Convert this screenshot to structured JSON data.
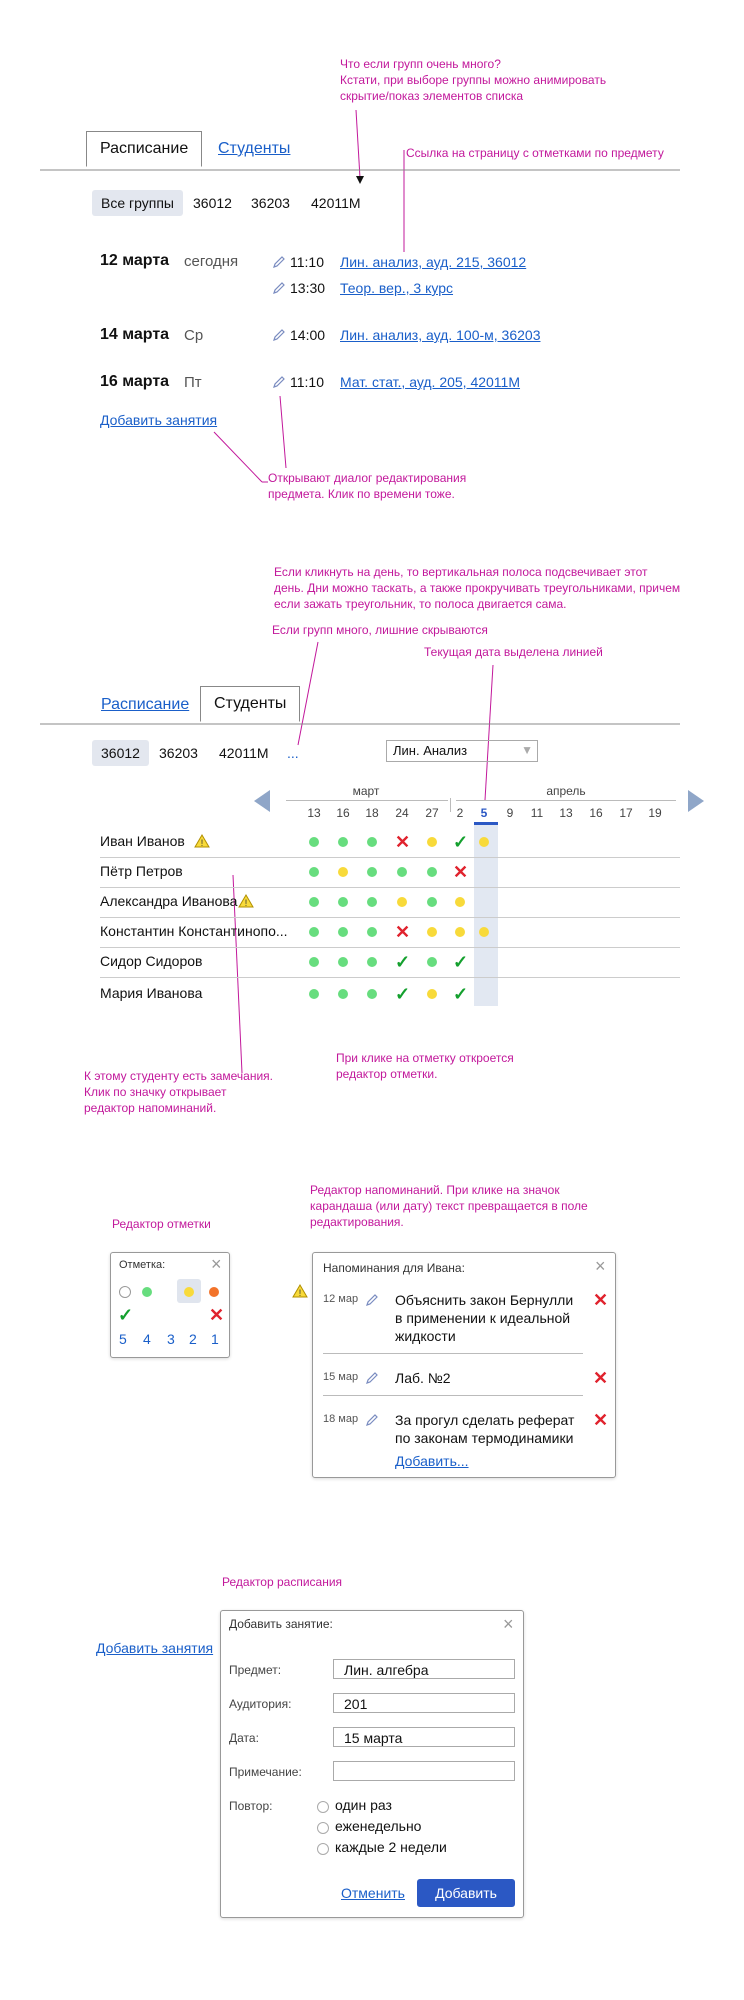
{
  "notes": {
    "many_groups": [
      "Что если групп очень много?",
      "Кстати, при выборе группы можно анимировать",
      "скрытие/показ элементов списка"
    ],
    "link_page": "Ссылка на страницу с отметками по предмету",
    "dialog": [
      "Открывают диалог редактирования",
      "предмета. Клик по времени тоже."
    ],
    "day_click": [
      "Если кликнуть на день, то вертикальная полоса подсвечивает этот",
      "день. Дни можно таскать, а  также прокручивать треугольниками, причем",
      "если зажать треугольник, то полоса двигается сама."
    ],
    "hidden_groups": "Если групп много, лишние скрываются",
    "current_date": "Текущая дата выделена линией",
    "student_remarks": [
      "К этому студенту есть замечания.",
      "Клик по значку открывает",
      "редактор напоминаний."
    ],
    "mark_click": [
      "При клике на отметку откроется",
      "редактор отметки."
    ],
    "mark_editor": "Редактор отметки",
    "reminder_editor": [
      "Редактор напоминаний. При клике на значок",
      "карандаша (или дату) текст превращается в поле",
      "редактирования."
    ],
    "schedule_editor": "Редактор расписания"
  },
  "schedule": {
    "tabs": {
      "schedule": "Расписание",
      "students": "Студенты"
    },
    "groups": [
      "Все группы",
      "36012",
      "36203",
      "42011M"
    ],
    "days": [
      {
        "date": "12 марта",
        "weekday": "сегодня",
        "classes": [
          {
            "time": "11:10",
            "title": "Лин. анализ, ауд. 215, 36012"
          },
          {
            "time": "13:30",
            "title": "Теор. вер., 3 курс"
          }
        ]
      },
      {
        "date": "14 марта",
        "weekday": "Ср",
        "classes": [
          {
            "time": "14:00",
            "title": "Лин. анализ, ауд. 100-м, 36203"
          }
        ]
      },
      {
        "date": "16 марта",
        "weekday": "Пт",
        "classes": [
          {
            "time": "11:10",
            "title": "Мат. стат., ауд. 205, 42011M"
          }
        ]
      }
    ],
    "add_lesson": "Добавить занятия"
  },
  "students": {
    "tabs": {
      "schedule": "Расписание",
      "students": "Студенты"
    },
    "groups": [
      "36012",
      "36203",
      "42011M"
    ],
    "more": "...",
    "subject_select": "Лин. Анализ",
    "months": {
      "march": "март",
      "april": "апрель"
    },
    "dates": [
      "13",
      "16",
      "18",
      "24",
      "27",
      "2",
      "5",
      "9",
      "11",
      "13",
      "16",
      "17",
      "19"
    ],
    "current_date_index": 6,
    "rows": [
      {
        "name": "Иван Иванов",
        "warn": true,
        "marks": [
          "g",
          "g",
          "g",
          "x",
          "y",
          "c",
          "y"
        ]
      },
      {
        "name": "Пётр Петров",
        "warn": false,
        "marks": [
          "g",
          "y",
          "g",
          "g",
          "g",
          "x",
          ""
        ]
      },
      {
        "name": "Александра Иванова",
        "warn": true,
        "marks": [
          "g",
          "g",
          "g",
          "y",
          "g",
          "y",
          ""
        ]
      },
      {
        "name": "Константин Константинопо...",
        "warn": false,
        "marks": [
          "g",
          "g",
          "g",
          "x",
          "y",
          "y",
          "y"
        ]
      },
      {
        "name": "Сидор Сидоров",
        "warn": false,
        "marks": [
          "g",
          "g",
          "g",
          "c",
          "g",
          "c",
          ""
        ]
      },
      {
        "name": "Мария Иванова",
        "warn": false,
        "marks": [
          "g",
          "g",
          "g",
          "c",
          "y",
          "c",
          ""
        ]
      }
    ]
  },
  "mark_editor": {
    "title": "Отметка:",
    "grades": [
      "5",
      "4",
      "3",
      "2",
      "1"
    ]
  },
  "reminders": {
    "title": "Напоминания для Ивана:",
    "items": [
      {
        "date": "12 мар",
        "text": [
          "Объяснить закон Бернулли",
          "в применении к идеальной",
          "жидкости"
        ]
      },
      {
        "date": "15 мар",
        "text": [
          "Лаб. №2"
        ]
      },
      {
        "date": "18 мар",
        "text": [
          "За прогул сделать реферат",
          "по законам термодинамики"
        ]
      }
    ],
    "add": "Добавить..."
  },
  "add_dialog": {
    "link": "Добавить занятия",
    "title": "Добавить занятие:",
    "fields": {
      "subject": {
        "label": "Предмет:",
        "value": "Лин. алгебра"
      },
      "room": {
        "label": "Аудитория:",
        "value": "201"
      },
      "date": {
        "label": "Дата:",
        "value": "15 марта"
      },
      "note": {
        "label": "Примечание:",
        "value": ""
      }
    },
    "repeat_label": "Повтор:",
    "repeat_options": [
      "один раз",
      "еженедельно",
      "каждые 2 недели"
    ],
    "cancel": "Отменить",
    "submit": "Добавить"
  }
}
